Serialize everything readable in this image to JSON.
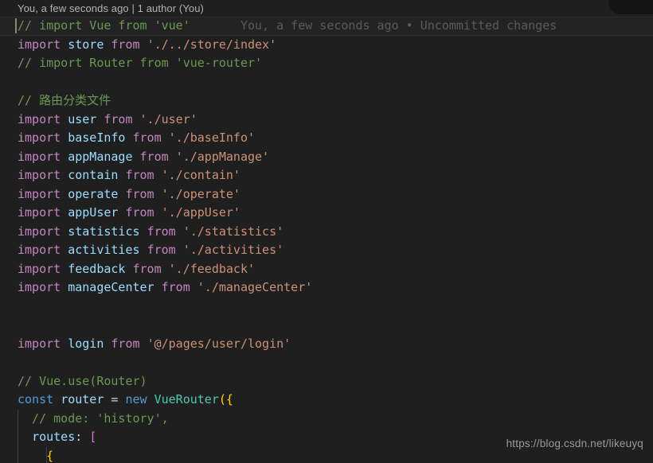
{
  "editor": {
    "language": "javascript",
    "background_color": "#1f1f1f",
    "active_line_color": "#232323",
    "default_text_color": "#d4d4d4",
    "font_size_px": 15,
    "line_height_px": 23.5
  },
  "codelens": {
    "blame_summary": "You, a few seconds ago | 1 author (You)"
  },
  "inline_blame": {
    "text": "You, a few seconds ago • Uncommitted changes",
    "color": "#5a5a5a"
  },
  "token_colors": {
    "comment": "#6a9955",
    "keyword": "#c586c0",
    "control": "#569cd6",
    "identifier": "#9cdcfe",
    "string": "#ce9178",
    "class": "#4ec9b0",
    "punctuation": "#d4d4d4"
  },
  "watermark": {
    "text": "https://blog.csdn.net/likeuyq"
  },
  "code_lines": [
    {
      "n": 1,
      "active": true,
      "tokens": [
        {
          "t": "// import Vue from 'vue'",
          "c": "comment"
        }
      ],
      "blame": "You, a few seconds ago • Uncommitted changes"
    },
    {
      "n": 2,
      "active": false,
      "tokens": [
        {
          "t": "import",
          "c": "keyword"
        },
        {
          "t": " ",
          "c": "punct"
        },
        {
          "t": "store",
          "c": "ident"
        },
        {
          "t": " ",
          "c": "punct"
        },
        {
          "t": "from",
          "c": "keyword"
        },
        {
          "t": " ",
          "c": "punct"
        },
        {
          "t": "'./../store/index'",
          "c": "string"
        }
      ]
    },
    {
      "n": 3,
      "active": false,
      "tokens": [
        {
          "t": "// import Router from 'vue-router'",
          "c": "comment"
        }
      ]
    },
    {
      "n": 4,
      "active": false,
      "tokens": []
    },
    {
      "n": 5,
      "active": false,
      "tokens": [
        {
          "t": "// 路由分类文件",
          "c": "comment"
        }
      ]
    },
    {
      "n": 6,
      "active": false,
      "tokens": [
        {
          "t": "import",
          "c": "keyword"
        },
        {
          "t": " ",
          "c": "punct"
        },
        {
          "t": "user",
          "c": "ident"
        },
        {
          "t": " ",
          "c": "punct"
        },
        {
          "t": "from",
          "c": "keyword"
        },
        {
          "t": " ",
          "c": "punct"
        },
        {
          "t": "'./user'",
          "c": "string"
        }
      ]
    },
    {
      "n": 7,
      "active": false,
      "tokens": [
        {
          "t": "import",
          "c": "keyword"
        },
        {
          "t": " ",
          "c": "punct"
        },
        {
          "t": "baseInfo",
          "c": "ident"
        },
        {
          "t": " ",
          "c": "punct"
        },
        {
          "t": "from",
          "c": "keyword"
        },
        {
          "t": " ",
          "c": "punct"
        },
        {
          "t": "'./baseInfo'",
          "c": "string"
        }
      ]
    },
    {
      "n": 8,
      "active": false,
      "tokens": [
        {
          "t": "import",
          "c": "keyword"
        },
        {
          "t": " ",
          "c": "punct"
        },
        {
          "t": "appManage",
          "c": "ident"
        },
        {
          "t": " ",
          "c": "punct"
        },
        {
          "t": "from",
          "c": "keyword"
        },
        {
          "t": " ",
          "c": "punct"
        },
        {
          "t": "'./appManage'",
          "c": "string"
        }
      ]
    },
    {
      "n": 9,
      "active": false,
      "tokens": [
        {
          "t": "import",
          "c": "keyword"
        },
        {
          "t": " ",
          "c": "punct"
        },
        {
          "t": "contain",
          "c": "ident"
        },
        {
          "t": " ",
          "c": "punct"
        },
        {
          "t": "from",
          "c": "keyword"
        },
        {
          "t": " ",
          "c": "punct"
        },
        {
          "t": "'./contain'",
          "c": "string"
        }
      ]
    },
    {
      "n": 10,
      "active": false,
      "tokens": [
        {
          "t": "import",
          "c": "keyword"
        },
        {
          "t": " ",
          "c": "punct"
        },
        {
          "t": "operate",
          "c": "ident"
        },
        {
          "t": " ",
          "c": "punct"
        },
        {
          "t": "from",
          "c": "keyword"
        },
        {
          "t": " ",
          "c": "punct"
        },
        {
          "t": "'./operate'",
          "c": "string"
        }
      ]
    },
    {
      "n": 11,
      "active": false,
      "tokens": [
        {
          "t": "import",
          "c": "keyword"
        },
        {
          "t": " ",
          "c": "punct"
        },
        {
          "t": "appUser",
          "c": "ident"
        },
        {
          "t": " ",
          "c": "punct"
        },
        {
          "t": "from",
          "c": "keyword"
        },
        {
          "t": " ",
          "c": "punct"
        },
        {
          "t": "'./appUser'",
          "c": "string"
        }
      ]
    },
    {
      "n": 12,
      "active": false,
      "tokens": [
        {
          "t": "import",
          "c": "keyword"
        },
        {
          "t": " ",
          "c": "punct"
        },
        {
          "t": "statistics",
          "c": "ident"
        },
        {
          "t": " ",
          "c": "punct"
        },
        {
          "t": "from",
          "c": "keyword"
        },
        {
          "t": " ",
          "c": "punct"
        },
        {
          "t": "'./statistics'",
          "c": "string"
        }
      ]
    },
    {
      "n": 13,
      "active": false,
      "tokens": [
        {
          "t": "import",
          "c": "keyword"
        },
        {
          "t": " ",
          "c": "punct"
        },
        {
          "t": "activities",
          "c": "ident"
        },
        {
          "t": " ",
          "c": "punct"
        },
        {
          "t": "from",
          "c": "keyword"
        },
        {
          "t": " ",
          "c": "punct"
        },
        {
          "t": "'./activities'",
          "c": "string"
        }
      ]
    },
    {
      "n": 14,
      "active": false,
      "tokens": [
        {
          "t": "import",
          "c": "keyword"
        },
        {
          "t": " ",
          "c": "punct"
        },
        {
          "t": "feedback",
          "c": "ident"
        },
        {
          "t": " ",
          "c": "punct"
        },
        {
          "t": "from",
          "c": "keyword"
        },
        {
          "t": " ",
          "c": "punct"
        },
        {
          "t": "'./feedback'",
          "c": "string"
        }
      ]
    },
    {
      "n": 15,
      "active": false,
      "tokens": [
        {
          "t": "import",
          "c": "keyword"
        },
        {
          "t": " ",
          "c": "punct"
        },
        {
          "t": "manageCenter",
          "c": "ident"
        },
        {
          "t": " ",
          "c": "punct"
        },
        {
          "t": "from",
          "c": "keyword"
        },
        {
          "t": " ",
          "c": "punct"
        },
        {
          "t": "'./manageCenter'",
          "c": "string"
        }
      ]
    },
    {
      "n": 16,
      "active": false,
      "tokens": []
    },
    {
      "n": 17,
      "active": false,
      "tokens": []
    },
    {
      "n": 18,
      "active": false,
      "tokens": [
        {
          "t": "import",
          "c": "keyword"
        },
        {
          "t": " ",
          "c": "punct"
        },
        {
          "t": "login",
          "c": "ident"
        },
        {
          "t": " ",
          "c": "punct"
        },
        {
          "t": "from",
          "c": "keyword"
        },
        {
          "t": " ",
          "c": "punct"
        },
        {
          "t": "'@/pages/user/login'",
          "c": "string"
        }
      ]
    },
    {
      "n": 19,
      "active": false,
      "tokens": []
    },
    {
      "n": 20,
      "active": false,
      "tokens": [
        {
          "t": "// Vue.use(Router)",
          "c": "comment"
        }
      ]
    },
    {
      "n": 21,
      "active": false,
      "tokens": [
        {
          "t": "const",
          "c": "ctrl"
        },
        {
          "t": " ",
          "c": "punct"
        },
        {
          "t": "router",
          "c": "ident"
        },
        {
          "t": " ",
          "c": "punct"
        },
        {
          "t": "=",
          "c": "op"
        },
        {
          "t": " ",
          "c": "punct"
        },
        {
          "t": "new",
          "c": "ctrl"
        },
        {
          "t": " ",
          "c": "punct"
        },
        {
          "t": "VueRouter",
          "c": "class"
        },
        {
          "t": "(",
          "c": "brace1"
        },
        {
          "t": "{",
          "c": "brace1"
        }
      ]
    },
    {
      "n": 22,
      "active": false,
      "indent": 1,
      "tokens": [
        {
          "t": "  // mode: 'history',",
          "c": "comment"
        }
      ]
    },
    {
      "n": 23,
      "active": false,
      "indent": 1,
      "tokens": [
        {
          "t": "  ",
          "c": "punct"
        },
        {
          "t": "routes",
          "c": "prop"
        },
        {
          "t": ":",
          "c": "punct"
        },
        {
          "t": " ",
          "c": "punct"
        },
        {
          "t": "[",
          "c": "brace2"
        }
      ]
    },
    {
      "n": 24,
      "active": false,
      "indent": 2,
      "tokens": [
        {
          "t": "    ",
          "c": "punct"
        },
        {
          "t": "{",
          "c": "brace1"
        }
      ]
    }
  ]
}
